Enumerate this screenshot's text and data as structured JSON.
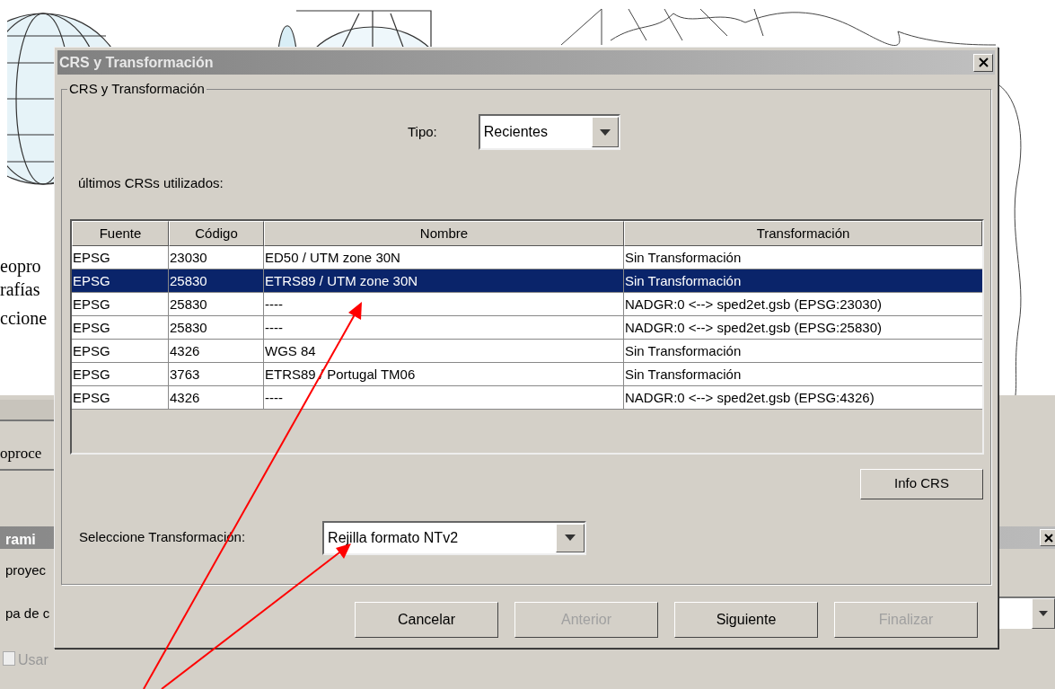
{
  "background": {
    "left_texts": [
      "eopro",
      "rafías",
      "ccione"
    ],
    "button_label": "oproce",
    "window_title": "rami",
    "rows": [
      "proyec",
      "pa de c"
    ],
    "checkbox": {
      "label": "Usar",
      "checked": false
    }
  },
  "dialog": {
    "title": "CRS y Transformación",
    "group_title": "CRS y Transformación",
    "tipo_label": "Tipo:",
    "tipo_value": "Recientes",
    "list_label": "últimos CRSs utilizados:",
    "table": {
      "columns": [
        "Fuente",
        "Código",
        "Nombre",
        "Transformación"
      ],
      "rows": [
        {
          "cells": [
            "EPSG",
            "23030",
            "ED50 / UTM zone 30N",
            "Sin Transformación"
          ],
          "selected": false
        },
        {
          "cells": [
            "EPSG",
            "25830",
            "ETRS89 / UTM zone 30N",
            "Sin Transformación"
          ],
          "selected": true
        },
        {
          "cells": [
            "EPSG",
            "25830",
            "----",
            "NADGR:0 <--> sped2et.gsb (EPSG:23030)"
          ],
          "selected": false
        },
        {
          "cells": [
            "EPSG",
            "25830",
            "----",
            "NADGR:0 <--> sped2et.gsb (EPSG:25830)"
          ],
          "selected": false
        },
        {
          "cells": [
            "EPSG",
            "4326",
            "WGS 84",
            "Sin Transformación"
          ],
          "selected": false
        },
        {
          "cells": [
            "EPSG",
            "3763",
            "ETRS89 / Portugal TM06",
            "Sin Transformación"
          ],
          "selected": false
        },
        {
          "cells": [
            "EPSG",
            "4326",
            "----",
            "NADGR:0 <--> sped2et.gsb (EPSG:4326)"
          ],
          "selected": false
        }
      ]
    },
    "info_button": "Info CRS",
    "transform_label": "Seleccione Transformación:",
    "transform_value": "Rejilla formato NTv2",
    "buttons": [
      {
        "label": "Cancelar",
        "disabled": false
      },
      {
        "label": "Anterior",
        "disabled": true
      },
      {
        "label": "Siguiente",
        "disabled": false
      },
      {
        "label": "Finalizar",
        "disabled": true
      }
    ]
  }
}
